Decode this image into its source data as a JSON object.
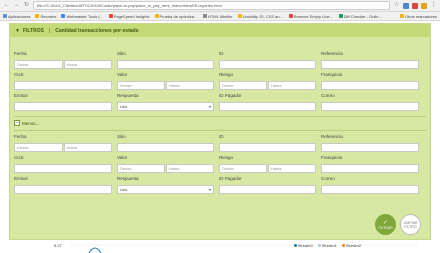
{
  "browser": {
    "url": "file:///C:/DUI1_Clientes/ARTICA%20Colab/place-to-pay/place_to_pay_html_marzo/html/05-reportes.html",
    "bookmarks": [
      "Aplicaciones",
      "Recortes",
      "Webmaster Tools (…",
      "PageSpeed Insights",
      "Prueba de optimiza…",
      "HTML Minifier",
      "Unicidity JS, CSS an…",
      "Remove Empty Line…",
      "Diff Checker - Onlin…"
    ],
    "other_bookmarks": "Otros marcadores"
  },
  "panel": {
    "title": "FILTROS",
    "subtitle": "Cantidad transacciones por estado",
    "menos_label": "Menos..."
  },
  "labels": {
    "fecha": "Fecha",
    "sitio": "Sitio",
    "id": "ID",
    "referencia": "Referencia",
    "cus": "CUS",
    "valor": "Valor",
    "riesgo": "Riesgo",
    "franquicia": "Franquicia",
    "emisor": "Emisor",
    "respuesta": "Respuesta",
    "id_pagador": "ID Pagador",
    "correo": "Correo"
  },
  "placeholders": {
    "desde": "Desde",
    "hasta": "Hasta"
  },
  "respuesta_value": "Uno",
  "buttons": {
    "filtrar": "FILTRAR",
    "limpiar_1": "LIMPIAR",
    "limpiar_2": "FILTRO"
  },
  "chart": {
    "y_tick": "9.27",
    "legend": [
      "Stream0",
      "Stream1",
      "Stream2"
    ],
    "colors": [
      "#1f77b4",
      "#aec7e8",
      "#ff7f0e"
    ]
  }
}
